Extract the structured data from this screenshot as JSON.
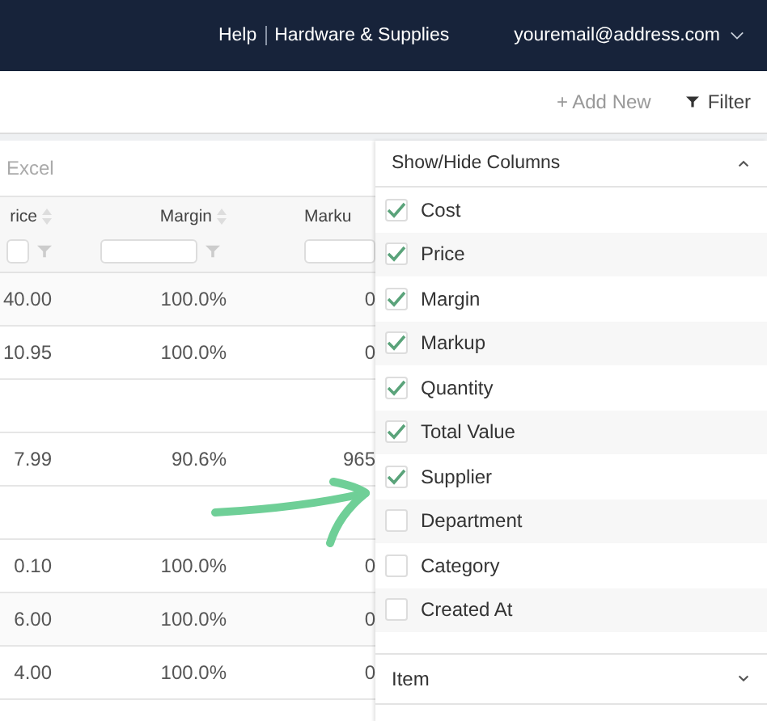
{
  "header": {
    "links": [
      "Help",
      "Hardware & Supplies"
    ],
    "user": "youremail@address.com"
  },
  "toolbar": {
    "add_new": "+ Add New",
    "filter": "Filter"
  },
  "export": {
    "label": "Excel"
  },
  "table": {
    "columns": [
      {
        "label": "rice",
        "sortable": true,
        "filter": true
      },
      {
        "label": "Margin",
        "sortable": true,
        "filter": true
      },
      {
        "label": "Marku",
        "sortable": false,
        "filter": false
      }
    ],
    "rows": [
      {
        "kind": "data",
        "cells": [
          "40.00",
          "100.0%",
          "0"
        ]
      },
      {
        "kind": "data",
        "cells": [
          "10.95",
          "100.0%",
          "0"
        ]
      },
      {
        "kind": "blank"
      },
      {
        "kind": "data",
        "cells": [
          "7.99",
          "90.6%",
          "965"
        ]
      },
      {
        "kind": "blank"
      },
      {
        "kind": "data",
        "cells": [
          "0.10",
          "100.0%",
          "0"
        ]
      },
      {
        "kind": "data",
        "cells": [
          "6.00",
          "100.0%",
          "0"
        ]
      },
      {
        "kind": "data",
        "cells": [
          "4.00",
          "100.0%",
          "0"
        ]
      }
    ]
  },
  "columns_panel": {
    "title": "Show/Hide Columns",
    "expanded": true,
    "items": [
      {
        "label": "Cost",
        "checked": true
      },
      {
        "label": "Price",
        "checked": true
      },
      {
        "label": "Margin",
        "checked": true
      },
      {
        "label": "Markup",
        "checked": true
      },
      {
        "label": "Quantity",
        "checked": true
      },
      {
        "label": "Total Value",
        "checked": true
      },
      {
        "label": "Supplier",
        "checked": true
      },
      {
        "label": "Department",
        "checked": false
      },
      {
        "label": "Category",
        "checked": false
      },
      {
        "label": "Created At",
        "checked": false
      }
    ],
    "sections": [
      {
        "label": "Item",
        "expanded": false
      }
    ]
  }
}
